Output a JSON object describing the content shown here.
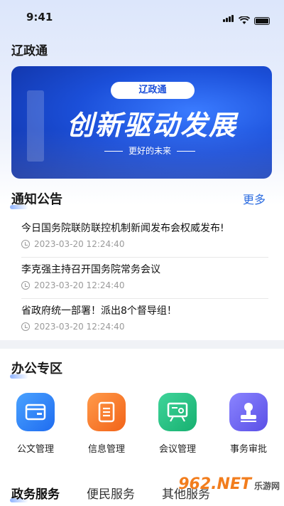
{
  "status_bar": {
    "time": "9:41"
  },
  "app": {
    "title": "辽政通"
  },
  "banner": {
    "pill": "辽政通",
    "slogan": "创新驱动发展",
    "subtitle": "更好的未来"
  },
  "notices": {
    "title": "通知公告",
    "more": "更多",
    "items": [
      {
        "title": "今日国务院联防联控机制新闻发布会权威发布!",
        "time": "2023-03-20  12:24:40"
      },
      {
        "title": "李克强主持召开国务院常务会议",
        "time": "2023-03-20  12:24:40"
      },
      {
        "title": "省政府统一部署！派出8个督导组！",
        "time": "2023-03-20  12:24:40"
      }
    ]
  },
  "office": {
    "title": "办公专区",
    "items": [
      {
        "label": "公文管理",
        "icon": "document-folder-icon",
        "color": "#1f6cf0"
      },
      {
        "label": "信息管理",
        "icon": "clipboard-icon",
        "color": "#f26318"
      },
      {
        "label": "会议管理",
        "icon": "presentation-board-icon",
        "color": "#17b070"
      },
      {
        "label": "事务审批",
        "icon": "stamp-icon",
        "color": "#5a4fe6"
      }
    ]
  },
  "bottom_tabs": [
    {
      "label": "政务服务",
      "active": true
    },
    {
      "label": "便民服务",
      "active": false
    },
    {
      "label": "其他服务",
      "active": false
    }
  ],
  "watermark": {
    "brand": "962.NET",
    "sub": "乐游网"
  }
}
